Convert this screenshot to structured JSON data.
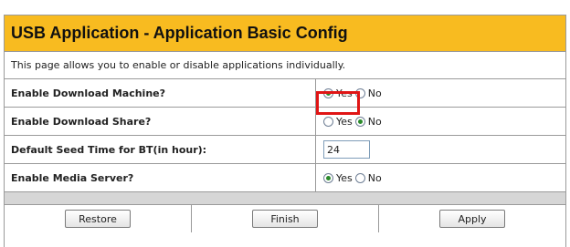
{
  "header": {
    "title": "USB Application - Application Basic Config"
  },
  "description": "This page allows you to enable or disable applications individually.",
  "rows": [
    {
      "label": "Enable Download Machine?",
      "options": [
        "Yes",
        "No"
      ],
      "selected": "Yes"
    },
    {
      "label": "Enable Download Share?",
      "options": [
        "Yes",
        "No"
      ],
      "selected": "No"
    },
    {
      "label": "Default Seed Time for BT(in hour):",
      "value": "24"
    },
    {
      "label": "Enable Media Server?",
      "options": [
        "Yes",
        "No"
      ],
      "selected": "Yes"
    }
  ],
  "buttons": {
    "restore": "Restore",
    "finish": "Finish",
    "apply": "Apply"
  },
  "colors": {
    "header_bg": "#f8bb20",
    "highlight": "#e01515",
    "radio_checked": "#2a8a2a"
  }
}
